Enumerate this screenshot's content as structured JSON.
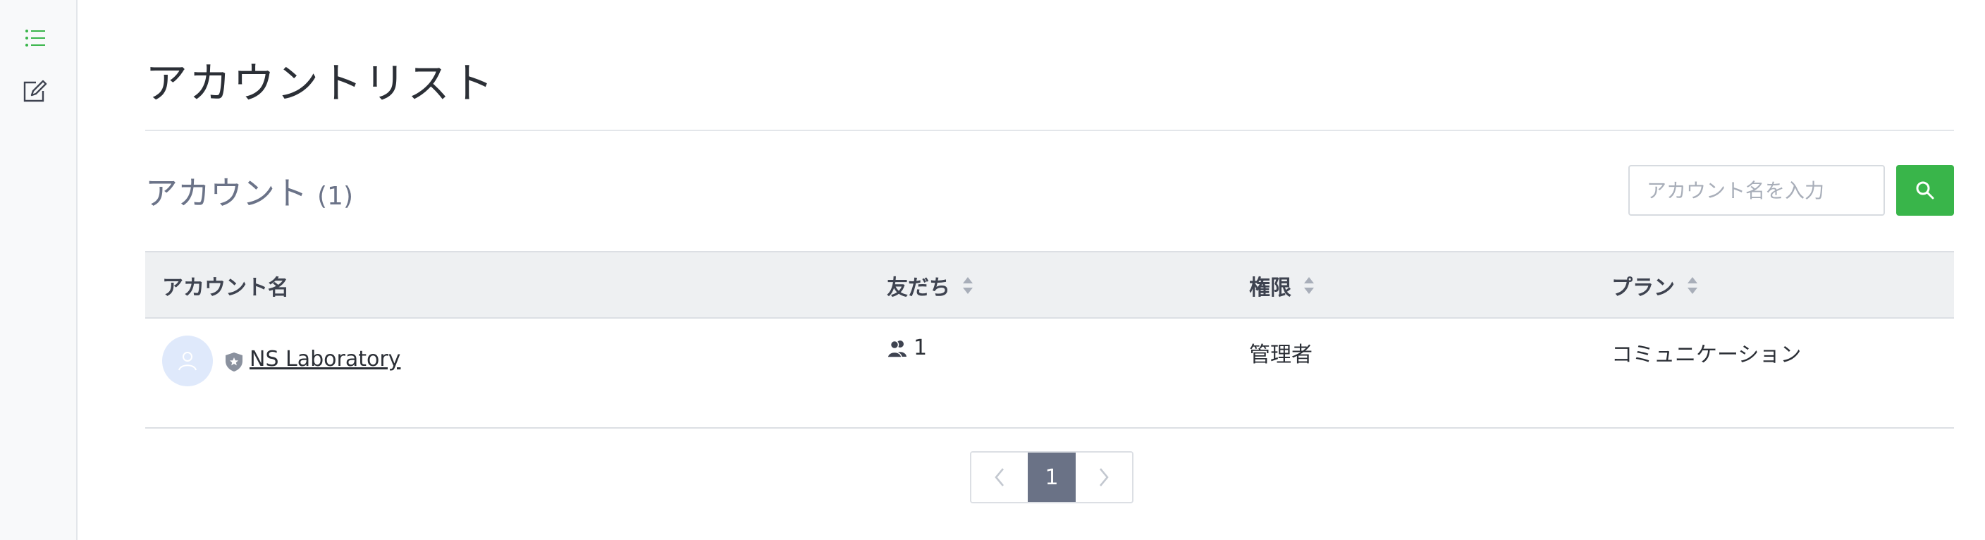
{
  "sidebar": {
    "items": [
      {
        "icon": "list-icon",
        "active": true
      },
      {
        "icon": "edit-icon",
        "active": false
      }
    ]
  },
  "page": {
    "title": "アカウントリスト"
  },
  "section": {
    "title": "アカウント",
    "count": "(1)"
  },
  "search": {
    "placeholder": "アカウント名を入力",
    "button_icon": "search-icon"
  },
  "table": {
    "headers": [
      "アカウント名",
      "友だち",
      "権限",
      "プラン"
    ],
    "sortable": [
      false,
      true,
      true,
      true
    ],
    "rows": [
      {
        "name": "NS Laboratory",
        "friends": "1",
        "role": "管理者",
        "plan": "コミュニケーション"
      }
    ]
  },
  "pagination": {
    "current": "1"
  },
  "colors": {
    "accent": "#39b54a",
    "page_current": "#6a7286",
    "avatar_bg": "#dfe9fb"
  }
}
